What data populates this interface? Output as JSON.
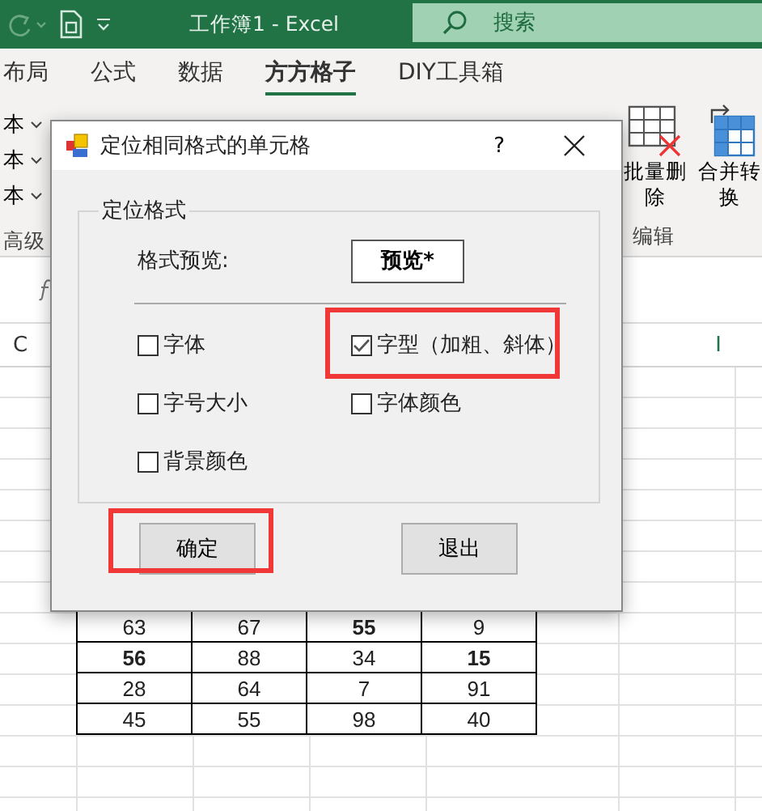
{
  "title_bar": {
    "title": "工作簿1  -  Excel",
    "search_placeholder": "搜索"
  },
  "ribbon_tabs": [
    {
      "label": "布局",
      "selected": false
    },
    {
      "label": "公式",
      "selected": false
    },
    {
      "label": "数据",
      "selected": false
    },
    {
      "label": "方方格子",
      "selected": true
    },
    {
      "label": "DIY工具箱",
      "selected": false
    }
  ],
  "ribbon": {
    "left_items": [
      "本",
      "本",
      "本"
    ],
    "left_group_label": "高级",
    "right_tools": [
      {
        "label": "批量删除",
        "kind": "delete"
      },
      {
        "label": "合并转换",
        "kind": "merge"
      }
    ],
    "right_group_label": "编辑"
  },
  "sheet": {
    "column_headers": [
      "C",
      "I"
    ],
    "rows": [
      [
        {
          "text": "63",
          "bold": false
        },
        {
          "text": "67",
          "bold": false
        },
        {
          "text": "55",
          "bold": true
        },
        {
          "text": "9",
          "bold": false
        }
      ],
      [
        {
          "text": "56",
          "bold": true
        },
        {
          "text": "88",
          "bold": false
        },
        {
          "text": "34",
          "bold": false
        },
        {
          "text": "15",
          "bold": true
        }
      ],
      [
        {
          "text": "28",
          "bold": false
        },
        {
          "text": "64",
          "bold": false
        },
        {
          "text": "7",
          "bold": false
        },
        {
          "text": "91",
          "bold": false
        }
      ],
      [
        {
          "text": "45",
          "bold": false
        },
        {
          "text": "55",
          "bold": false
        },
        {
          "text": "98",
          "bold": false
        },
        {
          "text": "40",
          "bold": false
        }
      ]
    ]
  },
  "dialog": {
    "title": "定位相同格式的单元格",
    "help": "?",
    "group_label": "定位格式",
    "preview_label": "格式预览:",
    "preview_button": "预览*",
    "options": [
      {
        "label": "字体",
        "checked": false,
        "highlighted": false
      },
      {
        "label": "字型（加粗、斜体）",
        "checked": true,
        "highlighted": true
      },
      {
        "label": "字号大小",
        "checked": false,
        "highlighted": false
      },
      {
        "label": "字体颜色",
        "checked": false,
        "highlighted": false
      },
      {
        "label": "背景颜色",
        "checked": false,
        "highlighted": false
      }
    ],
    "buttons": [
      {
        "label": "确定",
        "highlighted": true
      },
      {
        "label": "退出",
        "highlighted": false
      }
    ]
  }
}
